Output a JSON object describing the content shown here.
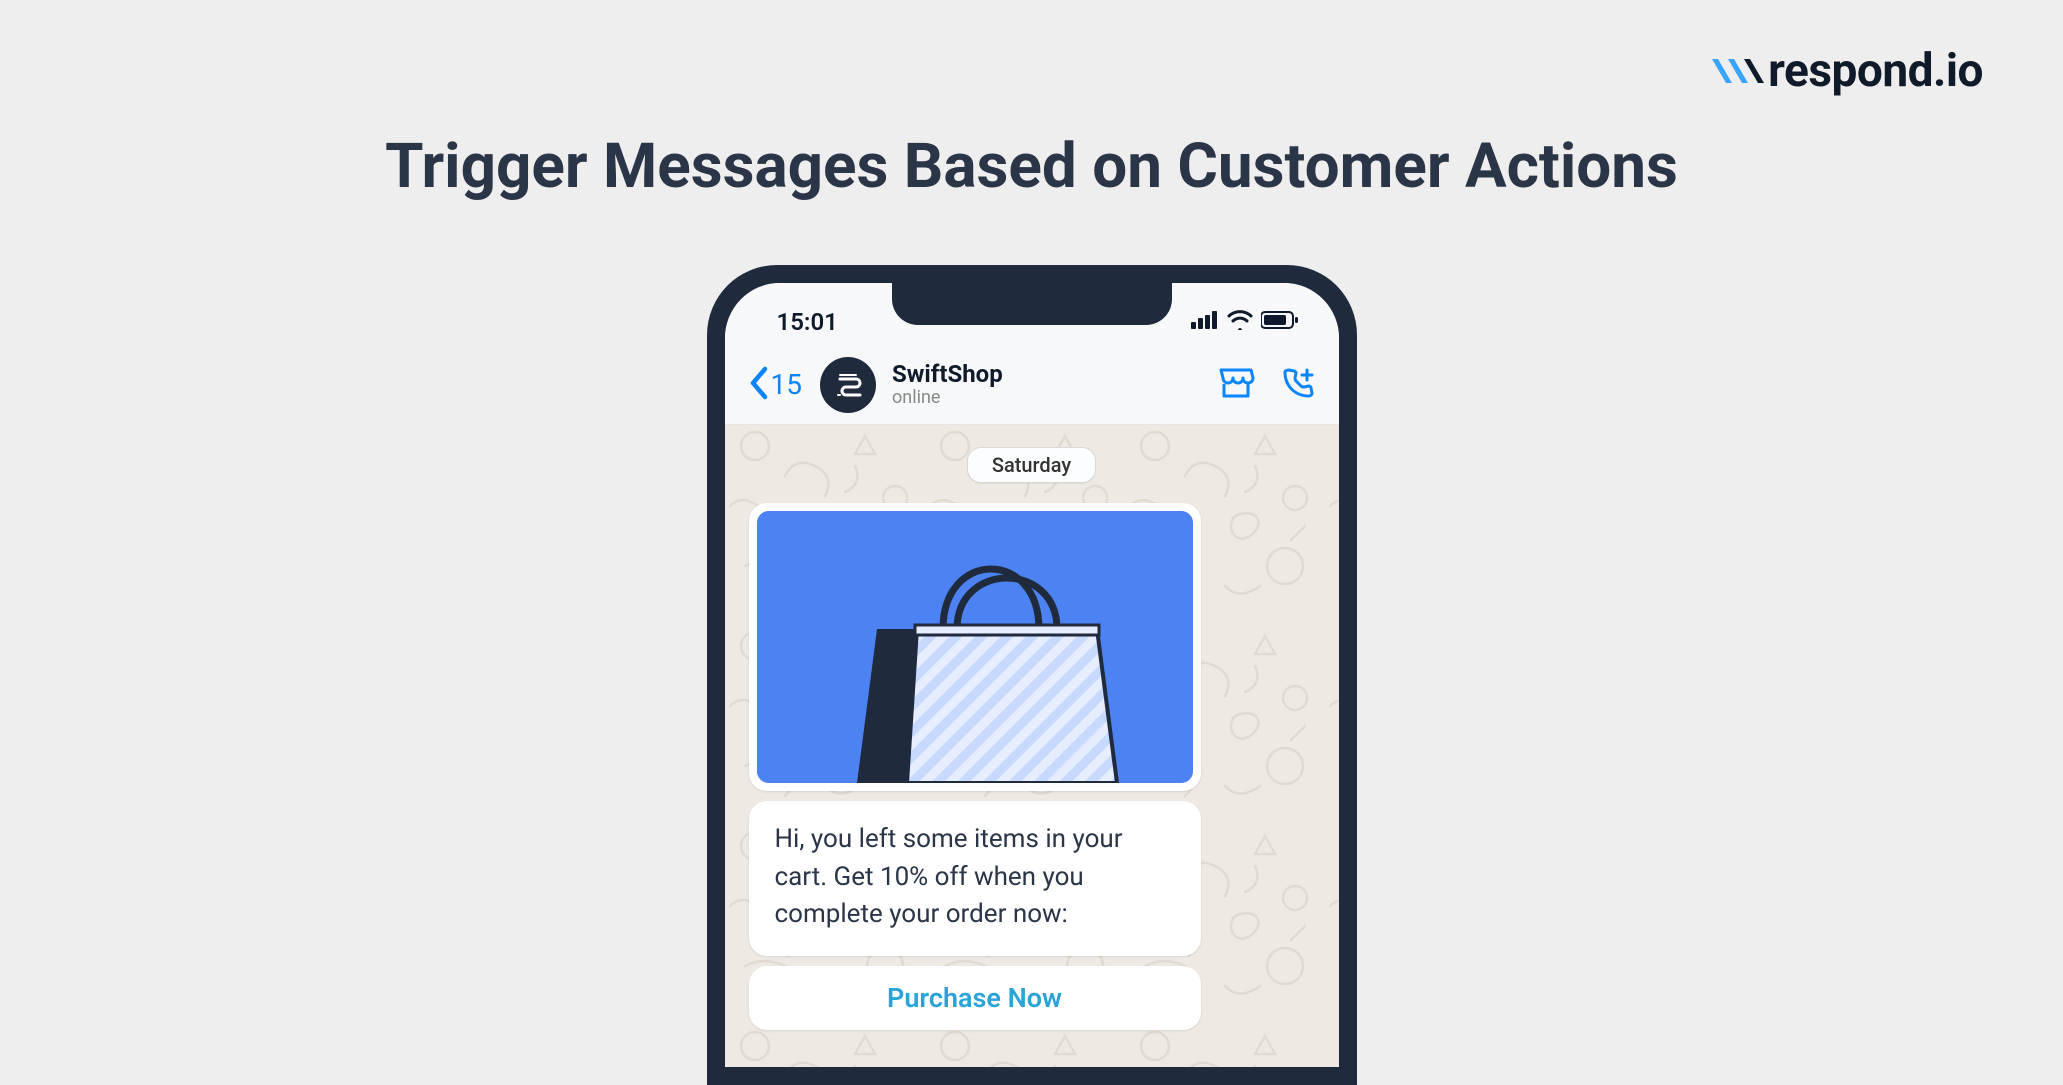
{
  "brand": {
    "name": "respond.io",
    "accent": "#0a84ff"
  },
  "heading": "Trigger Messages Based on Customer Actions",
  "phone": {
    "statusbar": {
      "time": "15:01"
    },
    "header": {
      "back_count": "15",
      "contact_name": "SwiftShop",
      "contact_status": "online"
    },
    "chat": {
      "date_label": "Saturday",
      "message_text": "Hi, you left some items in your cart. Get 10% off when you complete your order now:",
      "cta_label": "Purchase Now",
      "image_alt": "shopping-bag-graphic"
    }
  },
  "colors": {
    "phone_frame": "#1f2b3d",
    "heading_text": "#2a3547",
    "page_bg": "#eeeeee",
    "chat_bg": "#eeeae3",
    "ios_blue": "#0a84ff",
    "cta_blue": "#2aa3d8",
    "image_bg": "#4d82f3"
  }
}
